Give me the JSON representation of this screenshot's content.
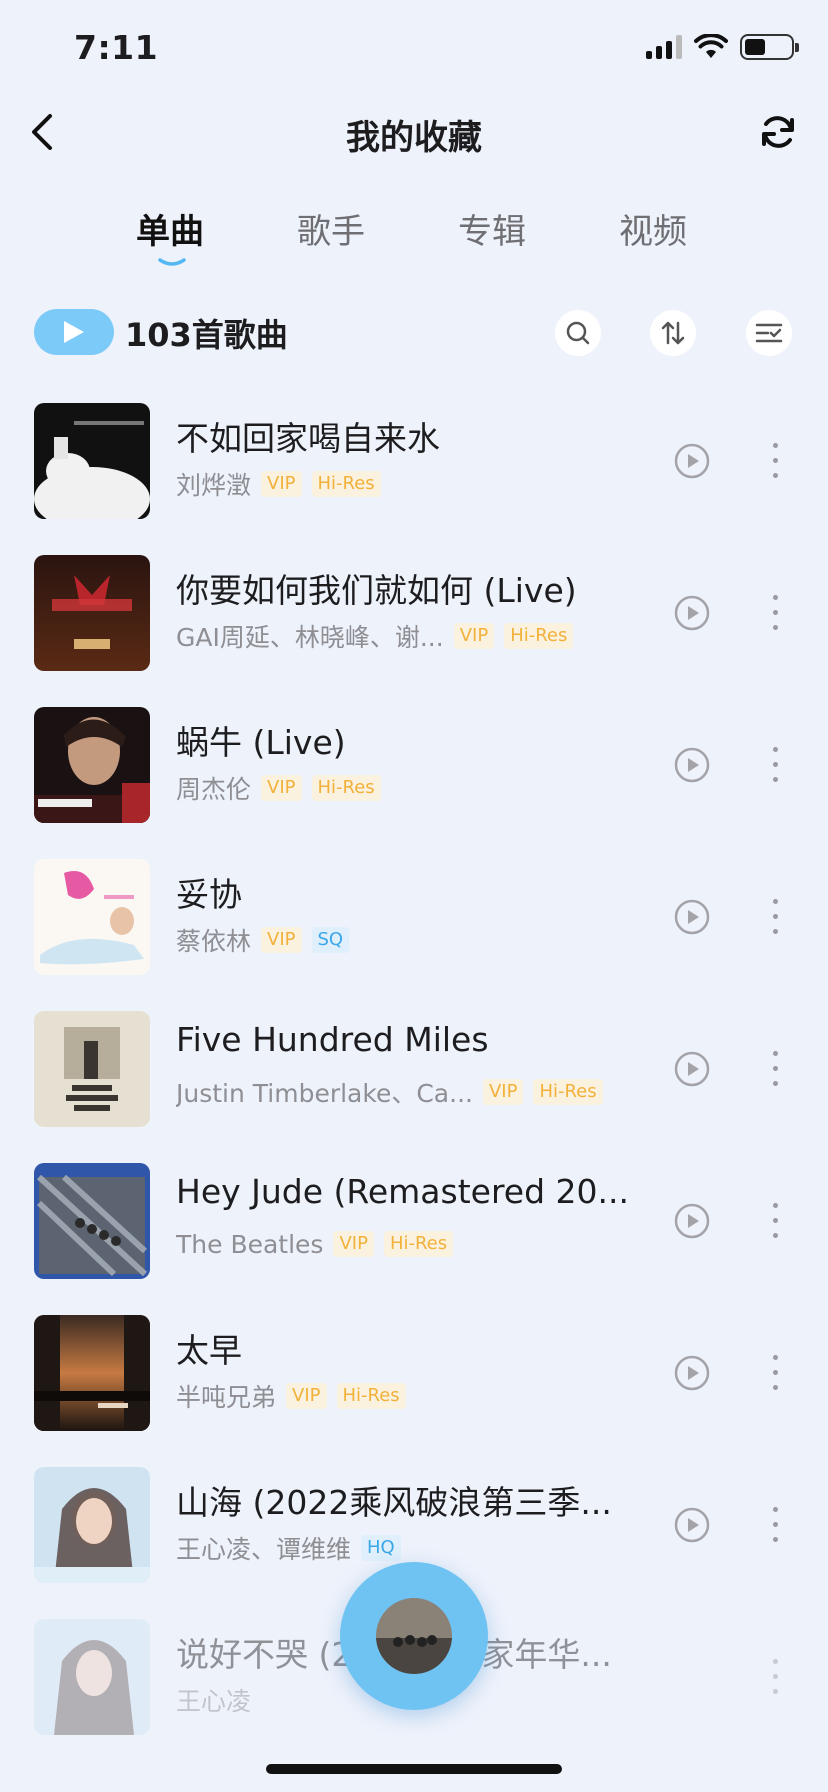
{
  "status_bar": {
    "time": "7:11",
    "battery_level": 0.45
  },
  "nav": {
    "title": "我的收藏"
  },
  "tabs": [
    {
      "label": "单曲",
      "active": true
    },
    {
      "label": "歌手",
      "active": false
    },
    {
      "label": "专辑",
      "active": false
    },
    {
      "label": "视频",
      "active": false
    }
  ],
  "toolbar": {
    "count_text": "103首歌曲"
  },
  "songs": [
    {
      "title": "不如回家喝自来水",
      "artist": "刘烨澂",
      "badges": [
        "VIP",
        "Hi-Res"
      ]
    },
    {
      "title": "你要如何我们就如何 (Live)",
      "artist": "GAI周延、林晓峰、谢...",
      "badges": [
        "VIP",
        "Hi-Res"
      ]
    },
    {
      "title": "蜗牛 (Live)",
      "artist": "周杰伦",
      "badges": [
        "VIP",
        "Hi-Res"
      ]
    },
    {
      "title": "妥协",
      "artist": "蔡依林",
      "badges": [
        "VIP",
        "SQ"
      ]
    },
    {
      "title": "Five Hundred Miles",
      "artist": "Justin Timberlake、Ca...",
      "badges": [
        "VIP",
        "Hi-Res"
      ]
    },
    {
      "title": "Hey Jude (Remastered 20...",
      "artist": "The Beatles",
      "badges": [
        "VIP",
        "Hi-Res"
      ]
    },
    {
      "title": "太早",
      "artist": "半吨兄弟",
      "badges": [
        "VIP",
        "Hi-Res"
      ]
    },
    {
      "title": "山海 (2022乘风破浪第三季...",
      "artist": "王心凌、谭维维",
      "badges": [
        "HQ"
      ]
    },
    {
      "title": "说好不哭 (2023不息家年华...",
      "artist": "王心凌",
      "badges": []
    }
  ],
  "colors": {
    "accent": "#7ccaf8",
    "vip_badge": "#f2b13a",
    "quality_badge": "#3aa7e8",
    "background": "#eef2fb"
  }
}
